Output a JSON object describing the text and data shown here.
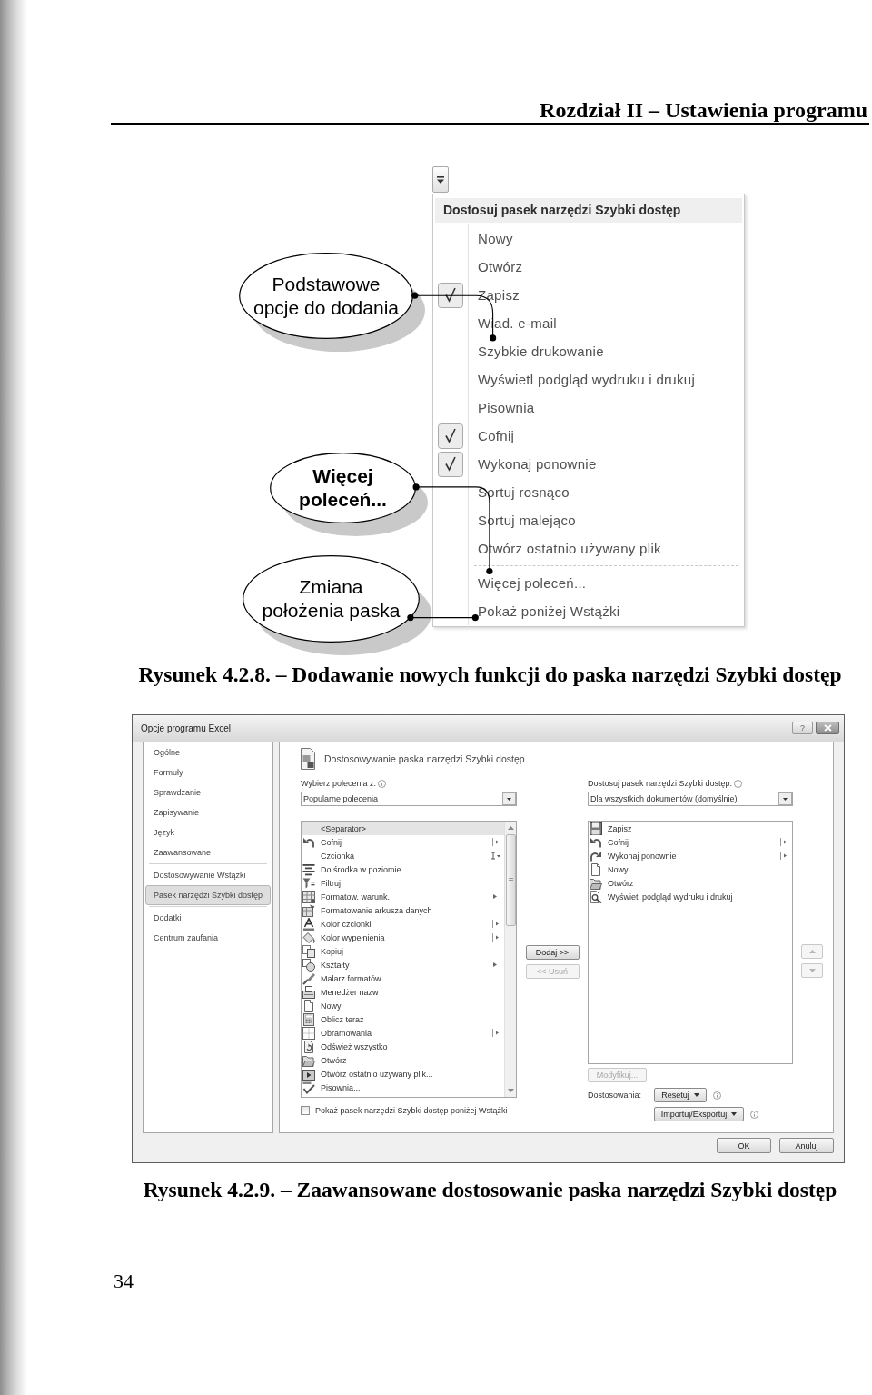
{
  "page_header": {
    "title": "Rozdział II – Ustawienia programu"
  },
  "figure_1": {
    "toolbar_menu": {
      "title": "Dostosuj pasek narzędzi Szybki dostęp",
      "items": [
        {
          "label": "Nowy",
          "checked": false
        },
        {
          "label": "Otwórz",
          "checked": false
        },
        {
          "label": "Zapisz",
          "checked": true
        },
        {
          "label": "Wiad. e-mail",
          "checked": false
        },
        {
          "label": "Szybkie drukowanie",
          "checked": false
        },
        {
          "label": "Wyświetl podgląd wydruku i drukuj",
          "checked": false
        },
        {
          "label": "Pisownia",
          "checked": false
        },
        {
          "label": "Cofnij",
          "checked": true
        },
        {
          "label": "Wykonaj ponownie",
          "checked": true
        },
        {
          "label": "Sortuj rosnąco",
          "checked": false
        },
        {
          "label": "Sortuj malejąco",
          "checked": false
        },
        {
          "label": "Otwórz ostatnio używany plik",
          "checked": false
        }
      ],
      "commands": [
        "Więcej poleceń...",
        "Pokaż poniżej Wstążki"
      ]
    },
    "callouts": [
      "Podstawowe opcje do dodania",
      "Więcej poleceń...",
      "Zmiana położenia paska"
    ],
    "caption": "Rysunek 4.2.8. – Dodawanie nowych funkcji do paska narzędzi Szybki dostęp"
  },
  "figure_2": {
    "dialog": {
      "title": "Opcje programu Excel",
      "help_button": "?",
      "sidebar": {
        "groups": [
          {
            "items": [
              {
                "label": "Ogólne",
                "selected": false
              },
              {
                "label": "Formuły",
                "selected": false
              },
              {
                "label": "Sprawdzanie",
                "selected": false
              },
              {
                "label": "Zapisywanie",
                "selected": false
              },
              {
                "label": "Język",
                "selected": false
              },
              {
                "label": "Zaawansowane",
                "selected": false
              }
            ]
          },
          {
            "items": [
              {
                "label": "Dostosowywanie Wstążki",
                "selected": false
              },
              {
                "label": "Pasek narzędzi Szybki dostęp",
                "selected": true
              }
            ]
          },
          {
            "items": [
              {
                "label": "Dodatki",
                "selected": false
              },
              {
                "label": "Centrum zaufania",
                "selected": false
              }
            ]
          }
        ]
      },
      "section_title": "Dostosowywanie paska narzędzi Szybki dostęp",
      "source": {
        "label": "Wybierz polecenia z:",
        "dropdown": "Popularne polecenia",
        "commands": [
          {
            "label": "<Separator>",
            "kind": "plain",
            "selected": true
          },
          {
            "label": "Cofnij",
            "kind": "split",
            "selected": false
          },
          {
            "label": "Czcionka",
            "kind": "fontbox",
            "selected": false
          },
          {
            "label": "Do środka w poziomie",
            "kind": "plain",
            "selected": false
          },
          {
            "label": "Filtruj",
            "kind": "plain",
            "selected": false
          },
          {
            "label": "Formatow. warunk.",
            "kind": "submenu",
            "selected": false
          },
          {
            "label": "Formatowanie arkusza danych",
            "kind": "plain",
            "selected": false
          },
          {
            "label": "Kolor czcionki",
            "kind": "split",
            "selected": false
          },
          {
            "label": "Kolor wypełnienia",
            "kind": "split",
            "selected": false
          },
          {
            "label": "Kopiuj",
            "kind": "plain",
            "selected": false
          },
          {
            "label": "Kształty",
            "kind": "submenu",
            "selected": false
          },
          {
            "label": "Malarz formatów",
            "kind": "plain",
            "selected": false
          },
          {
            "label": "Menedżer nazw",
            "kind": "plain",
            "selected": false
          },
          {
            "label": "Nowy",
            "kind": "plain",
            "selected": false
          },
          {
            "label": "Oblicz teraz",
            "kind": "plain",
            "selected": false
          },
          {
            "label": "Obramowania",
            "kind": "split",
            "selected": false
          },
          {
            "label": "Odśwież wszystko",
            "kind": "plain",
            "selected": false
          },
          {
            "label": "Otwórz",
            "kind": "plain",
            "selected": false
          },
          {
            "label": "Otwórz ostatnio używany plik...",
            "kind": "plain",
            "selected": false
          },
          {
            "label": "Pisownia...",
            "kind": "plain",
            "selected": false
          }
        ]
      },
      "show_below": {
        "label": "Pokaż pasek narzędzi Szybki dostęp poniżej Wstążki",
        "checked": false
      },
      "add_button": {
        "label": "Dodaj >>",
        "disabled": false
      },
      "remove_button": {
        "label": "<< Usuń",
        "disabled": true
      },
      "toolbar": {
        "label": "Dostosuj pasek narzędzi Szybki dostęp:",
        "dropdown": "Dla wszystkich dokumentów (domyślnie)",
        "commands": [
          {
            "label": "Zapisz",
            "kind": "plain",
            "selected": false
          },
          {
            "label": "Cofnij",
            "kind": "split",
            "selected": false
          },
          {
            "label": "Wykonaj ponownie",
            "kind": "split",
            "selected": false
          },
          {
            "label": "Nowy",
            "kind": "plain",
            "selected": false
          },
          {
            "label": "Otwórz",
            "kind": "plain",
            "selected": false
          },
          {
            "label": "Wyświetl podgląd wydruku i drukuj",
            "kind": "plain",
            "selected": false
          }
        ]
      },
      "move_up": {
        "disabled": true
      },
      "move_down": {
        "disabled": true
      },
      "modify_button": {
        "label": "Modyfikuj...",
        "disabled": true
      },
      "customizations": {
        "label": "Dostosowania:",
        "reset_button": "Resetuj",
        "import_export_button": "Importuj/Eksportuj"
      },
      "buttons": [
        "OK",
        "Anuluj"
      ]
    },
    "caption": "Rysunek 4.2.9. – Zaawansowane dostosowanie paska narzędzi Szybki dostęp"
  },
  "page_number": "34"
}
